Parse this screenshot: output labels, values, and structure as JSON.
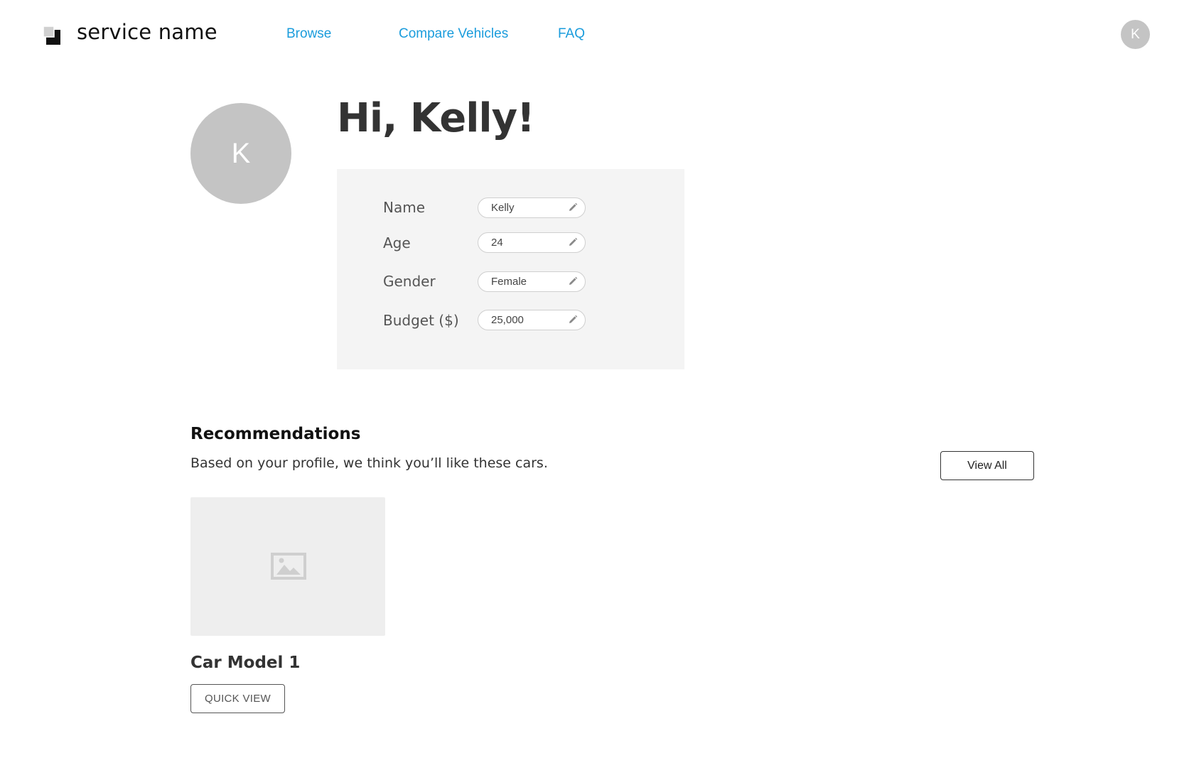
{
  "header": {
    "brand": "service name",
    "nav": {
      "browse": "Browse",
      "compare": "Compare Vehicles",
      "faq": "FAQ"
    },
    "avatar_initial": "K"
  },
  "profile": {
    "avatar_initial": "K",
    "greeting": "Hi, Kelly!",
    "fields": [
      {
        "label": "Name",
        "value": "Kelly"
      },
      {
        "label": "Age",
        "value": "24"
      },
      {
        "label": "Gender",
        "value": "Female"
      },
      {
        "label": "Budget ($)",
        "value": "25,000"
      }
    ]
  },
  "recommendations": {
    "heading": "Recommendations",
    "subtitle": "Based on your profile, we think you’ll like these cars.",
    "view_all_label": "View All",
    "cars": [
      {
        "name": "Car Model 1",
        "action_label": "QUICK VIEW"
      }
    ]
  },
  "colors": {
    "link": "#1a9cdc",
    "avatar": "#c4c4c4",
    "card_bg": "#f4f4f4",
    "image_placeholder": "#eeeeee"
  },
  "icons": [
    "logo-icon",
    "pencil-icon",
    "image-placeholder-icon"
  ]
}
